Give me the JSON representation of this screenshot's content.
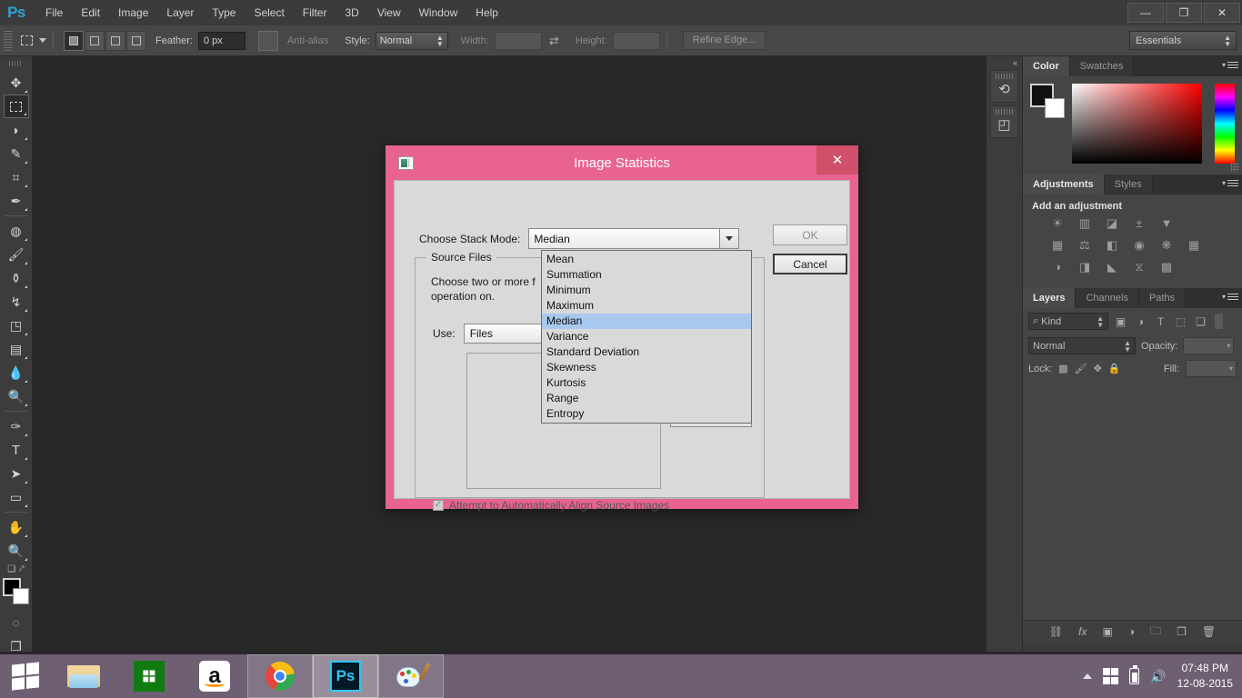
{
  "app": {
    "logo": "Ps",
    "menus": [
      "File",
      "Edit",
      "Image",
      "Layer",
      "Type",
      "Select",
      "Filter",
      "3D",
      "View",
      "Window",
      "Help"
    ],
    "window_controls": {
      "minimize": "—",
      "restore": "❐",
      "close": "✕"
    }
  },
  "options_bar": {
    "tool_icon": "rectangular-marquee-icon",
    "selection_modes": [
      "new-selection",
      "add-to-selection",
      "subtract-from-selection",
      "intersect-with-selection"
    ],
    "feather_label": "Feather:",
    "feather_value": "0 px",
    "antialias_label": "Anti-alias",
    "style_label": "Style:",
    "style_value": "Normal",
    "width_label": "Width:",
    "width_value": "",
    "height_label": "Height:",
    "height_value": "",
    "refine_edge_label": "Refine Edge...",
    "workspace": "Essentials"
  },
  "tools": [
    {
      "name": "move-tool",
      "glyph": "➤"
    },
    {
      "name": "rectangular-marquee-tool",
      "glyph": "⬚"
    },
    {
      "name": "lasso-tool",
      "glyph": "⊂"
    },
    {
      "name": "quick-selection-tool",
      "glyph": "✐"
    },
    {
      "name": "crop-tool",
      "glyph": "⌗"
    },
    {
      "name": "eyedropper-tool",
      "glyph": "✒"
    },
    {
      "name": "spot-healing-brush-tool",
      "glyph": "☉"
    },
    {
      "name": "brush-tool",
      "glyph": "✐"
    },
    {
      "name": "clone-stamp-tool",
      "glyph": "⚑"
    },
    {
      "name": "history-brush-tool",
      "glyph": "↗"
    },
    {
      "name": "eraser-tool",
      "glyph": "◰"
    },
    {
      "name": "gradient-tool",
      "glyph": "▤"
    },
    {
      "name": "blur-tool",
      "glyph": "●"
    },
    {
      "name": "dodge-tool",
      "glyph": "⚲"
    },
    {
      "name": "pen-tool",
      "glyph": "✒"
    },
    {
      "name": "horizontal-type-tool",
      "glyph": "T"
    },
    {
      "name": "path-selection-tool",
      "glyph": "➤"
    },
    {
      "name": "rectangle-tool",
      "glyph": "▭"
    },
    {
      "name": "hand-tool",
      "glyph": "✋"
    },
    {
      "name": "zoom-tool",
      "glyph": "⚲"
    }
  ],
  "tool_footer": {
    "foreground_color": "#000000",
    "background_color": "#ffffff",
    "quick_mask_icon": "quick-mask-icon",
    "screen_mode_icon": "screen-mode-icon",
    "swap_icon": "swap-colors-icon",
    "default_icon": "default-colors-icon"
  },
  "mini_dock": {
    "collapse_label": "«",
    "items": [
      {
        "name": "history-panel-icon",
        "glyph": "↺"
      },
      {
        "name": "3d-panel-icon",
        "glyph": "⬛"
      }
    ]
  },
  "panels": {
    "color": {
      "tabs": [
        "Color",
        "Swatches"
      ],
      "active_tab": "Color",
      "foreground": "#111111",
      "background": "#ffffff"
    },
    "adjustments": {
      "tabs": [
        "Adjustments",
        "Styles"
      ],
      "active_tab": "Adjustments",
      "heading": "Add an adjustment",
      "icon_rows": [
        [
          "brightness-contrast-icon",
          "levels-icon",
          "curves-icon",
          "exposure-icon",
          "vibrance-icon"
        ],
        [
          "hue-saturation-icon",
          "color-balance-icon",
          "black-white-icon",
          "photo-filter-icon",
          "channel-mixer-icon",
          "color-lookup-icon"
        ],
        [
          "invert-icon",
          "posterize-icon",
          "threshold-icon",
          "selective-color-icon",
          "gradient-map-icon"
        ]
      ]
    },
    "layers": {
      "tabs": [
        "Layers",
        "Channels",
        "Paths"
      ],
      "active_tab": "Layers",
      "filter_kind": "Kind",
      "filter_icons": [
        "pixel-layers-filter-icon",
        "adjustment-layers-filter-icon",
        "type-layers-filter-icon",
        "shape-layers-filter-icon",
        "smart-object-filter-icon"
      ],
      "blend_mode": "Normal",
      "opacity_label": "Opacity:",
      "opacity_value": "",
      "lock_label": "Lock:",
      "lock_icons": [
        "lock-transparent-pixels-icon",
        "lock-image-pixels-icon",
        "lock-position-icon",
        "lock-all-icon"
      ],
      "fill_label": "Fill:",
      "fill_value": "",
      "bottom_icons": [
        "link-layers-icon",
        "layer-style-icon",
        "layer-mask-icon",
        "new-adjustment-layer-icon",
        "new-group-icon",
        "new-layer-icon",
        "delete-layer-icon"
      ]
    }
  },
  "dialog": {
    "title": "Image Statistics",
    "icon": "image-statistics-icon",
    "close_label": "✕",
    "stack_mode_label": "Choose Stack Mode:",
    "stack_mode_value": "Median",
    "stack_mode_options": [
      "Mean",
      "Summation",
      "Minimum",
      "Maximum",
      "Median",
      "Variance",
      "Standard Deviation",
      "Skewness",
      "Kurtosis",
      "Range",
      "Entropy"
    ],
    "selected_option": "Median",
    "source_files_legend": "Source Files",
    "source_files_desc_line1": "Choose two or more f",
    "source_files_desc_line2": "operation on.",
    "use_label": "Use:",
    "use_value": "Files",
    "align_checkbox_label": "Attempt to Automatically Align Source Images",
    "align_checkbox_checked": true,
    "ok_label": "OK",
    "cancel_label": "Cancel",
    "titlebar_color": "#e8648f",
    "close_button_color": "#cf5068",
    "highlight_color": "#a8c8ee"
  },
  "taskbar": {
    "start_label": "start-button",
    "items": [
      {
        "name": "taskbar-file-explorer",
        "state": "pinned"
      },
      {
        "name": "taskbar-store",
        "state": "pinned"
      },
      {
        "name": "taskbar-amazon",
        "state": "pinned"
      },
      {
        "name": "taskbar-chrome",
        "state": "open"
      },
      {
        "name": "taskbar-photoshop",
        "state": "active"
      },
      {
        "name": "taskbar-paint",
        "state": "open"
      }
    ],
    "tray": [
      "show-hidden-icons",
      "windows-icon",
      "battery-icon",
      "volume-icon"
    ],
    "time": "07:48 PM",
    "date": "12-08-2015"
  }
}
